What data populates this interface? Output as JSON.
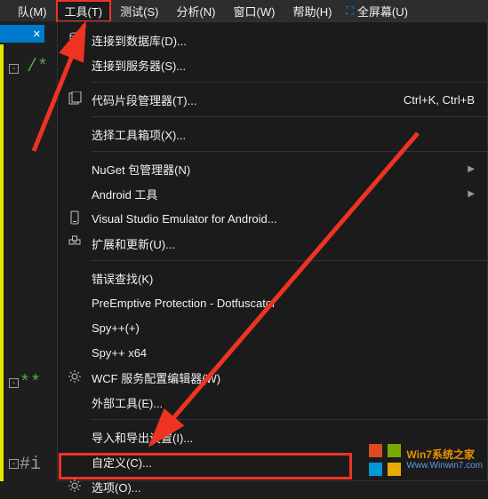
{
  "menubar": {
    "items": [
      {
        "label": "队(M)"
      },
      {
        "label": "工具(T)"
      },
      {
        "label": "测试(S)"
      },
      {
        "label": "分析(N)"
      },
      {
        "label": "窗口(W)"
      },
      {
        "label": "帮助(H)"
      }
    ],
    "fullscreen": "全屏幕(U)"
  },
  "bluestrip": {
    "x": "✕"
  },
  "gutter": {
    "comment1": "/*",
    "stars": "**",
    "preproc": "#i"
  },
  "menu": {
    "items": [
      {
        "label": "连接到数据库(D)...",
        "icon": "db-plug-icon"
      },
      {
        "label": "连接到服务器(S)..."
      },
      {
        "sep": true
      },
      {
        "label": "代码片段管理器(T)...",
        "icon": "snippet-icon",
        "shortcut": "Ctrl+K, Ctrl+B"
      },
      {
        "sep": true
      },
      {
        "label": "选择工具箱项(X)..."
      },
      {
        "sep": true
      },
      {
        "label": "NuGet 包管理器(N)",
        "arrow": true
      },
      {
        "label": "Android 工具",
        "arrow": true
      },
      {
        "label": "Visual Studio Emulator for Android...",
        "icon": "phone-icon"
      },
      {
        "label": "扩展和更新(U)...",
        "icon": "extensions-icon"
      },
      {
        "sep": true
      },
      {
        "label": "错误查找(K)"
      },
      {
        "label": "PreEmptive Protection - Dotfuscator"
      },
      {
        "label": "Spy++(+)"
      },
      {
        "label": "Spy++ x64"
      },
      {
        "label": "WCF 服务配置编辑器(W)",
        "icon": "gear-icon"
      },
      {
        "label": "外部工具(E)..."
      },
      {
        "sep": true
      },
      {
        "label": "导入和导出设置(I)..."
      },
      {
        "label": "自定义(C)..."
      },
      {
        "label": "选项(O)...",
        "icon": "gear-icon"
      }
    ]
  },
  "watermark": {
    "title": "Win7系统之家",
    "url": "Www.Winwin7.com"
  }
}
